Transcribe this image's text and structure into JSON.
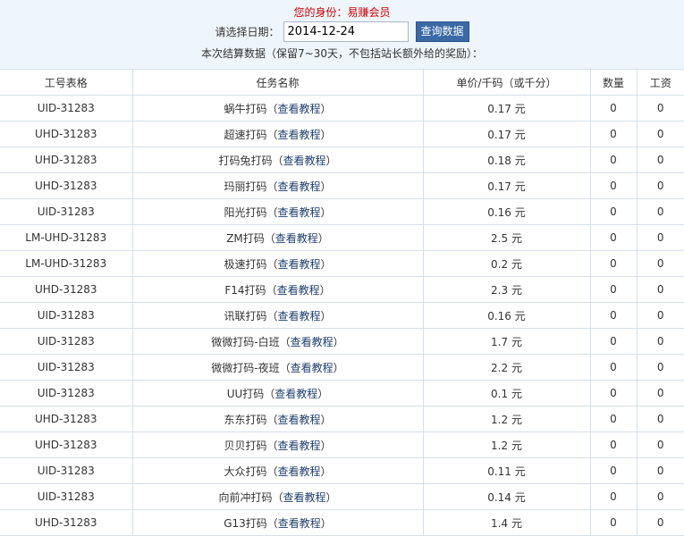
{
  "header": {
    "identity": "您的身份：易赚会员",
    "date_label": "请选择日期：",
    "date_value": "2014-12-24",
    "query_button": "查询数据",
    "note": "本次结算数据（保留7~30天，不包括站长额外给的奖励）："
  },
  "table": {
    "columns": [
      "工号表格",
      "任务名称",
      "单价/千码（或千分）",
      "数量",
      "工资"
    ],
    "tutorial_open": "（",
    "tutorial_link": "查看教程",
    "tutorial_close": "）",
    "rows": [
      {
        "id": "UID-31283",
        "task": "蜗牛打码",
        "price": "0.17 元",
        "qty": "0",
        "wage": "0"
      },
      {
        "id": "UHD-31283",
        "task": "超速打码",
        "price": "0.17 元",
        "qty": "0",
        "wage": "0"
      },
      {
        "id": "UHD-31283",
        "task": "打码兔打码",
        "price": "0.18 元",
        "qty": "0",
        "wage": "0"
      },
      {
        "id": "UHD-31283",
        "task": "玛丽打码",
        "price": "0.17 元",
        "qty": "0",
        "wage": "0"
      },
      {
        "id": "UID-31283",
        "task": "阳光打码",
        "price": "0.16 元",
        "qty": "0",
        "wage": "0"
      },
      {
        "id": "LM-UHD-31283",
        "task": "ZM打码",
        "price": "2.5 元",
        "qty": "0",
        "wage": "0"
      },
      {
        "id": "LM-UHD-31283",
        "task": "极速打码",
        "price": "0.2 元",
        "qty": "0",
        "wage": "0"
      },
      {
        "id": "UHD-31283",
        "task": "F14打码",
        "price": "2.3 元",
        "qty": "0",
        "wage": "0"
      },
      {
        "id": "UID-31283",
        "task": "讯联打码",
        "price": "0.16 元",
        "qty": "0",
        "wage": "0"
      },
      {
        "id": "UID-31283",
        "task": "微微打码-白班",
        "price": "1.7 元",
        "qty": "0",
        "wage": "0"
      },
      {
        "id": "UID-31283",
        "task": "微微打码-夜班",
        "price": "2.2 元",
        "qty": "0",
        "wage": "0"
      },
      {
        "id": "UID-31283",
        "task": "UU打码",
        "price": "0.1 元",
        "qty": "0",
        "wage": "0"
      },
      {
        "id": "UHD-31283",
        "task": "东东打码",
        "price": "1.2 元",
        "qty": "0",
        "wage": "0"
      },
      {
        "id": "UHD-31283",
        "task": "贝贝打码",
        "price": "1.2 元",
        "qty": "0",
        "wage": "0"
      },
      {
        "id": "UID-31283",
        "task": "大众打码",
        "price": "0.11 元",
        "qty": "0",
        "wage": "0"
      },
      {
        "id": "UID-31283",
        "task": "向前冲打码",
        "price": "0.14 元",
        "qty": "0",
        "wage": "0"
      },
      {
        "id": "UHD-31283",
        "task": "G13打码",
        "price": "1.4 元",
        "qty": "0",
        "wage": "0"
      }
    ]
  },
  "colors": {
    "identity": "#cc0000",
    "button": "#3a69a5",
    "header_bg": "#eef5fb",
    "link": "#1f3f6e",
    "grid_line": "#d5dfe8"
  }
}
